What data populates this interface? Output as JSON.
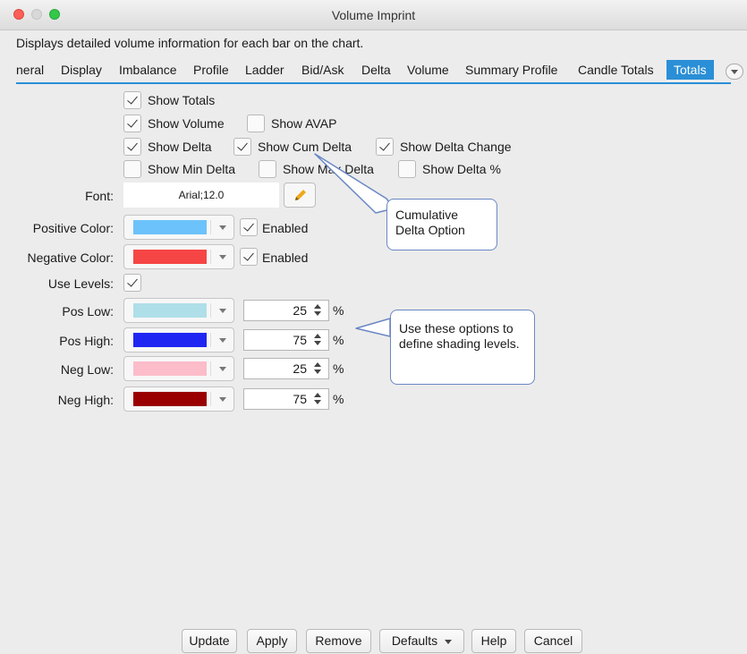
{
  "window": {
    "title": "Volume Imprint"
  },
  "description": "Displays detailed volume information for each bar on the chart.",
  "tabs": [
    "neral",
    "Display",
    "Imbalance",
    "Profile",
    "Ladder",
    "Bid/Ask",
    "Delta",
    "Volume",
    "Summary Profile",
    "Candle Totals",
    "Totals"
  ],
  "active_tab": "Totals",
  "checkboxes": {
    "show_totals": {
      "label": "Show Totals",
      "checked": true
    },
    "show_volume": {
      "label": "Show Volume",
      "checked": true
    },
    "show_avap": {
      "label": "Show AVAP",
      "checked": false
    },
    "show_delta": {
      "label": "Show Delta",
      "checked": true
    },
    "show_cum_delta": {
      "label": "Show Cum Delta",
      "checked": true
    },
    "show_delta_change": {
      "label": "Show Delta Change",
      "checked": true
    },
    "show_min_delta": {
      "label": "Show Min Delta",
      "checked": false
    },
    "show_max_delta": {
      "label": "Show Max Delta",
      "checked": false
    },
    "show_delta_pct": {
      "label": "Show Delta %",
      "checked": false
    }
  },
  "font": {
    "label": "Font:",
    "value": "Arial;12.0",
    "icon": "pencil-icon"
  },
  "positive_color": {
    "label": "Positive Color:",
    "color": "#6cc2fa",
    "enabled_label": "Enabled",
    "enabled": true
  },
  "negative_color": {
    "label": "Negative Color:",
    "color": "#f64545",
    "enabled_label": "Enabled",
    "enabled": true
  },
  "use_levels": {
    "label": "Use Levels:",
    "checked": true
  },
  "levels": {
    "pos_low": {
      "label": "Pos Low:",
      "color": "#afdfe8",
      "value": "25",
      "unit": "%"
    },
    "pos_high": {
      "label": "Pos High:",
      "color": "#1f26f2",
      "value": "75",
      "unit": "%"
    },
    "neg_low": {
      "label": "Neg Low:",
      "color": "#fcbcc9",
      "value": "25",
      "unit": "%"
    },
    "neg_high": {
      "label": "Neg High:",
      "color": "#9a0000",
      "value": "75",
      "unit": "%"
    }
  },
  "callouts": {
    "cum_delta": "Cumulative Delta Option",
    "shading": "Use these options to define shading levels."
  },
  "buttons": {
    "update": "Update",
    "apply": "Apply",
    "remove": "Remove",
    "defaults": "Defaults",
    "help": "Help",
    "cancel": "Cancel"
  }
}
